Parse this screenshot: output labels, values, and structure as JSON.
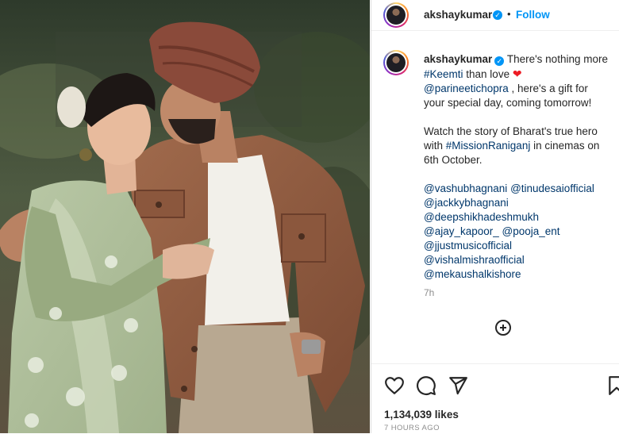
{
  "post": {
    "author": "akshaykumar",
    "follow_label": "Follow",
    "separator": "•",
    "caption": {
      "line1_text": "There's nothing more",
      "line2_hashtag": "#Keemti",
      "line2_text": " than love ",
      "heart": "❤",
      "line3_mention": "@parineetichopra",
      "line3_text": " , here's a gift for",
      "line4": "your special day, coming tomorrow!",
      "line5": "Watch the story of Bharat's true hero",
      "line6_pre": "with ",
      "line6_hashtag": "#MissionRaniganj",
      "line6_post": " in cinemas on",
      "line7": "6th October.",
      "mentions_row1": [
        "@vashubhagnani",
        "@tinudesaiofficial"
      ],
      "mentions_row2": [
        "@jackkybhagnani"
      ],
      "mentions_row3": [
        "@deepshikhadeshmukh"
      ],
      "mentions_row4": [
        "@ajay_kapoor_",
        "@pooja_ent"
      ],
      "mentions_row5": [
        "@jjustmusicofficial"
      ],
      "mentions_row6": [
        "@vishalmishraofficial"
      ],
      "mentions_row7": [
        "@mekaushalkishore"
      ]
    },
    "caption_time": "7h",
    "likes": "1,134,039 likes",
    "posted_ago": "7 HOURS AGO"
  },
  "icons": {
    "verified": "✓",
    "like": "heart-icon",
    "comment": "comment-icon",
    "share": "share-icon",
    "save": "bookmark-icon",
    "more_comments": "plus-circle-icon"
  },
  "colors": {
    "link": "#00376b",
    "follow": "#0095f6",
    "heart": "#ed1c24",
    "muted": "#8e8e8e"
  }
}
